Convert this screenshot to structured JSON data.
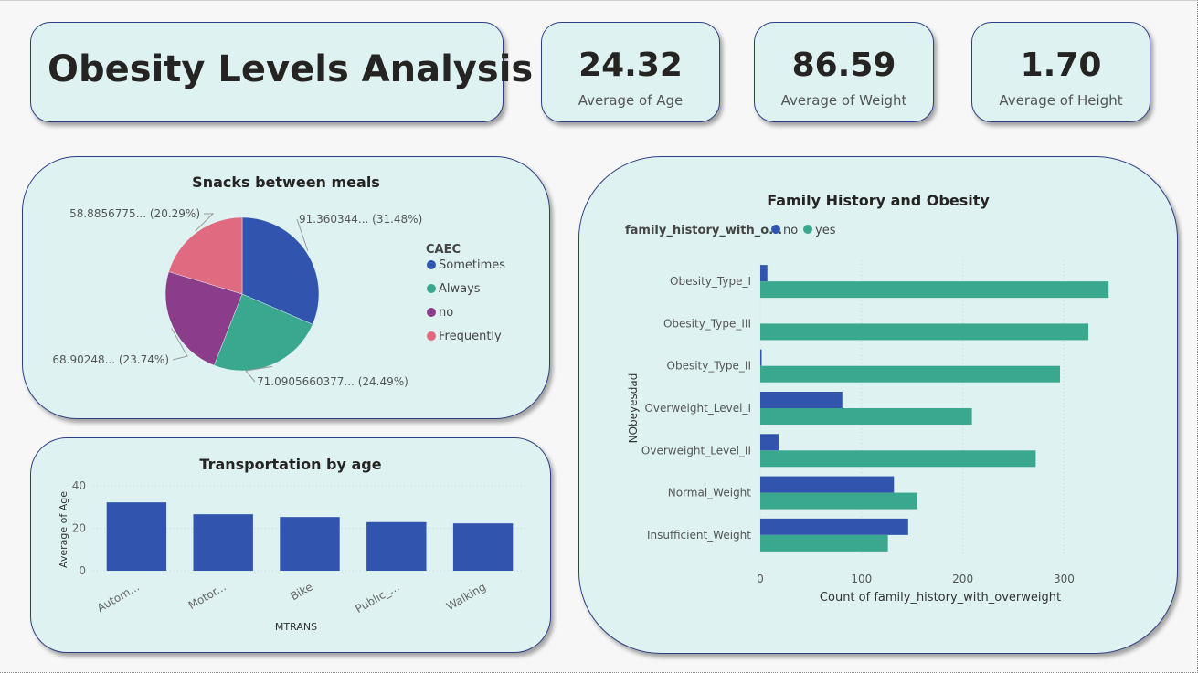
{
  "dashboard": {
    "title": "Obesity Levels Analysis"
  },
  "kpis": [
    {
      "value": "24.32",
      "label": "Average of Age"
    },
    {
      "value": "86.59",
      "label": "Average of Weight"
    },
    {
      "value": "1.70",
      "label": "Average of Height"
    }
  ],
  "colors": {
    "card_bg": "#dff2f2",
    "card_border": "#2c3f86",
    "blue": "#3155ae",
    "teal": "#3aa78f",
    "purple": "#8b3c8a",
    "pink": "#e06b80"
  },
  "chart_data": [
    {
      "type": "pie",
      "title": "Snacks between meals",
      "legend_title": "CAEC",
      "legend_position": "right",
      "slices": [
        {
          "name": "Sometimes",
          "value": 91.360344,
          "label": "91.360344... (31.48%)",
          "color": "#3155ae"
        },
        {
          "name": "Always",
          "value": 71.0905660377,
          "label": "71.0905660377... (24.49%)",
          "color": "#3aa78f"
        },
        {
          "name": "no",
          "value": 68.90248,
          "label": "68.90248... (23.74%)",
          "color": "#8b3c8a"
        },
        {
          "name": "Frequently",
          "value": 58.8856775,
          "label": "58.8856775... (20.29%)",
          "color": "#e06b80"
        }
      ]
    },
    {
      "type": "bar",
      "title": "Transportation by age",
      "xlabel": "MTRANS",
      "ylabel": "Average of Age",
      "categories": [
        "Autom...",
        "Motor...",
        "Bike",
        "Public_...",
        "Walking"
      ],
      "values": [
        32.2,
        26.6,
        25.3,
        22.9,
        22.3
      ],
      "ylim": [
        0,
        40
      ],
      "yticks": [
        0,
        20,
        40
      ],
      "color": "#3155ae"
    },
    {
      "type": "bar",
      "orientation": "horizontal",
      "title": "Family History and Obesity",
      "legend_title": "family_history_with_o...",
      "legend_position": "top-left",
      "xlabel": "Count of family_history_with_overweight",
      "ylabel": "NObeyesdad",
      "categories": [
        "Obesity_Type_I",
        "Obesity_Type_III",
        "Obesity_Type_II",
        "Overweight_Level_I",
        "Overweight_Level_II",
        "Normal_Weight",
        "Insufficient_Weight"
      ],
      "series": [
        {
          "name": "no",
          "values": [
            7,
            0,
            1,
            81,
            18,
            132,
            146
          ],
          "color": "#3155ae"
        },
        {
          "name": "yes",
          "values": [
            344,
            324,
            296,
            209,
            272,
            155,
            126
          ],
          "color": "#3aa78f"
        }
      ],
      "xlim": [
        0,
        350
      ],
      "xticks": [
        0,
        100,
        200,
        300
      ]
    }
  ]
}
